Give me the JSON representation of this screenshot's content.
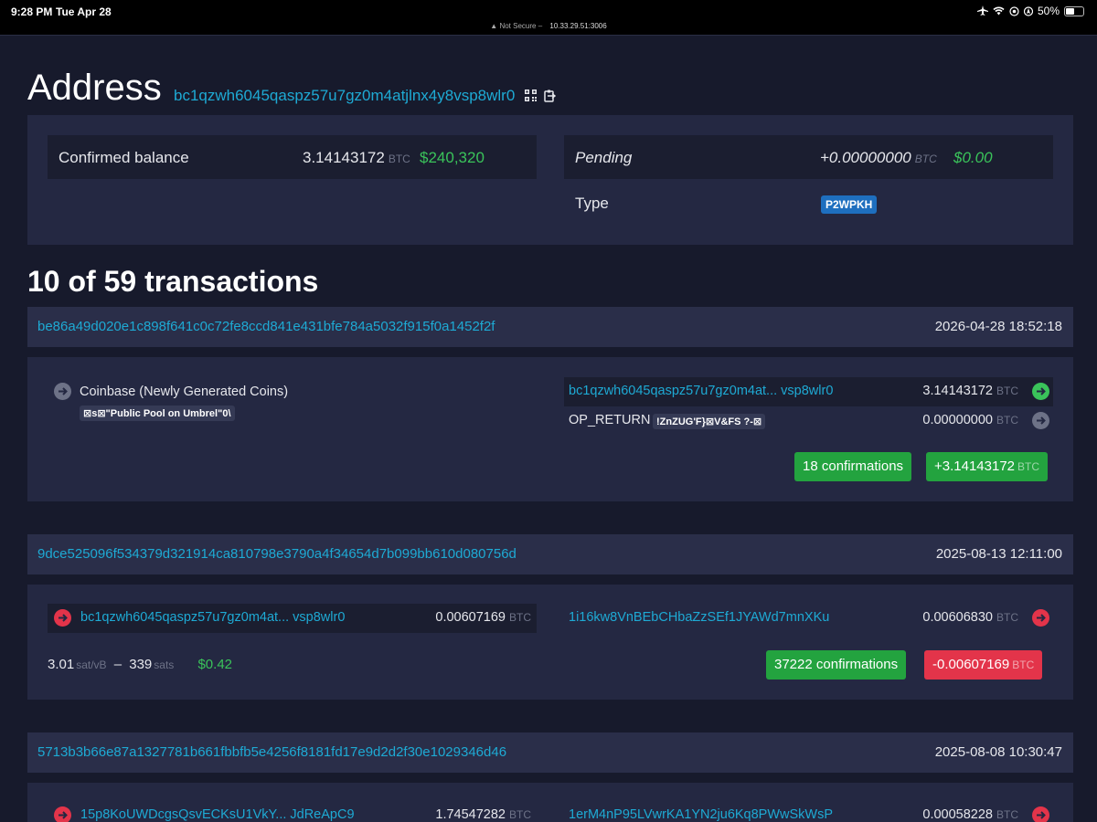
{
  "status_bar": {
    "time": "9:28 PM",
    "date": "Tue Apr 28",
    "battery": "50%",
    "url_warning": "Not Secure",
    "url": "10.33.29.51:3006"
  },
  "address": {
    "heading": "Address",
    "hash": "bc1qzwh6045qaspz57u7gz0m4atjlnx4y8vsp8wlr0",
    "icons": [
      "qr-code-icon",
      "copy-icon"
    ]
  },
  "summary": {
    "confirmed_label": "Confirmed balance",
    "confirmed_amount": "3.14143172",
    "confirmed_unit": "BTC",
    "confirmed_fiat": "$240,320",
    "pending_label": "Pending",
    "pending_amount": "+0.00000000",
    "pending_unit": "BTC",
    "pending_fiat": "$0.00",
    "type_label": "Type",
    "type_value": "P2WPKH"
  },
  "tx_section_title": "10 of 59 transactions",
  "transactions": [
    {
      "txid": "be86a49d020e1c898f641c0c72fe8ccd841e431bfe784a5032f915f0a1452f2f",
      "time": "2026-04-28 18:52:18",
      "input": {
        "label": "Coinbase (Newly Generated Coins)",
        "script": "⊠s⊠\"Public Pool on Umbrel\"0\\"
      },
      "outputs": [
        {
          "address": "bc1qzwh6045qaspz57u7gz0m4at... vsp8wlr0",
          "amount": "3.14143172",
          "unit": "BTC"
        },
        {
          "address": "OP_RETURN",
          "script": "!ZnZUG'F}⊠V&FS ?-⊠",
          "amount": "0.00000000",
          "unit": "BTC"
        }
      ],
      "confirmations": "18 confirmations",
      "delta": "+3.14143172",
      "delta_unit": "BTC"
    },
    {
      "txid": "9dce525096f534379d321914ca810798e3790a4f34654d7b099bb610d080756d",
      "time": "2025-08-13 12:11:00",
      "input": {
        "address": "bc1qzwh6045qaspz57u7gz0m4at... vsp8wlr0",
        "amount": "0.00607169",
        "unit": "BTC"
      },
      "output": {
        "address": "1i16kw8VnBEbCHbaZzSEf1JYAWd7mnXKu",
        "amount": "0.00606830",
        "unit": "BTC"
      },
      "fee_rate": "3.01",
      "fee_rate_unit": "sat/vB",
      "fee_sep": "–",
      "fee_sats": "339",
      "fee_sats_unit": "sats",
      "fee_fiat": "$0.42",
      "confirmations": "37222 confirmations",
      "delta": "-0.00607169",
      "delta_unit": "BTC"
    },
    {
      "txid": "5713b3b66e87a1327781b661fbbfb5e4256f8181fd17e9d2d2f30e1029346d46",
      "time": "2025-08-08 10:30:47",
      "input": {
        "address": "15p8KoUWDcgsQsvECKsU1VkY... JdReApC9",
        "amount": "1.74547282",
        "unit": "BTC"
      },
      "output": {
        "address": "1erM4nP95LVwrKA1YN2ju6Kq8PWwSkWsP",
        "amount": "0.00058228",
        "unit": "BTC"
      }
    }
  ],
  "colors": {
    "background": "#171a2c",
    "panel": "#242842",
    "link": "#1eaad4",
    "green": "#3ac35a",
    "red": "#e3344a",
    "type_badge": "#1e6fbf"
  }
}
